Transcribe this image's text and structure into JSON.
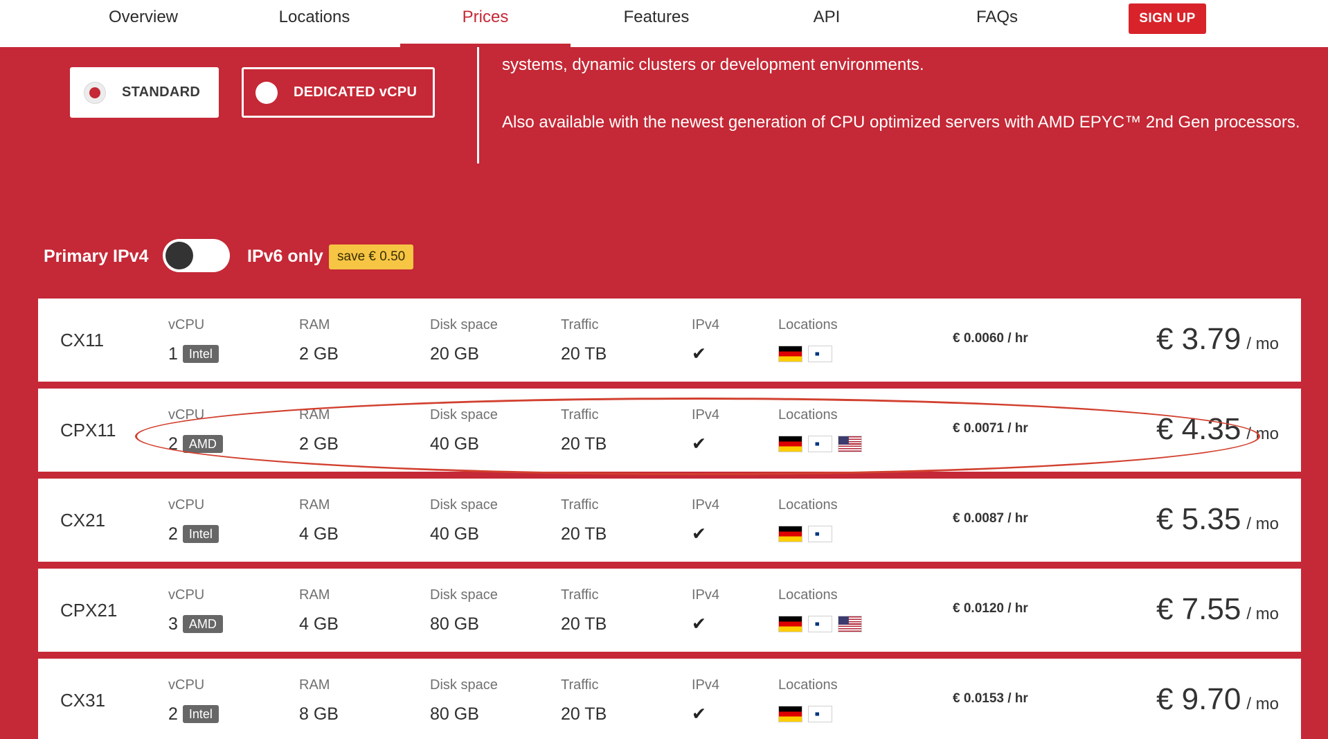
{
  "nav": {
    "items": [
      {
        "label": "Overview"
      },
      {
        "label": "Locations"
      },
      {
        "label": "Prices"
      },
      {
        "label": "Features"
      },
      {
        "label": "API"
      },
      {
        "label": "FAQs"
      }
    ],
    "active": "Prices",
    "signup_label": "SIGN UP"
  },
  "server_type": {
    "standard_label": "STANDARD",
    "dedicated_label": "DEDICATED vCPU",
    "selected": "STANDARD"
  },
  "description": {
    "line1": "systems, dynamic clusters or development environments.",
    "line2": "Also available with the newest generation of CPU optimized servers with AMD EPYC™ 2nd Gen processors."
  },
  "ip_toggle": {
    "primary_label": "Primary IPv4",
    "ipv6_label": "IPv6 only",
    "save_badge": "save € 0.50",
    "ipv6_only_enabled": false
  },
  "columns": {
    "vcpu": "vCPU",
    "ram": "RAM",
    "disk": "Disk space",
    "traffic": "Traffic",
    "ipv4": "IPv4",
    "locations": "Locations"
  },
  "plans": [
    {
      "name": "CX11",
      "vcpu": "1",
      "cpu_brand": "Intel",
      "ram": "2 GB",
      "disk": "20 GB",
      "traffic": "20 TB",
      "ipv4": "✔",
      "hourly": "€ 0.0060 / hr",
      "price": "€ 3.79",
      "unit": "/ mo"
    },
    {
      "name": "CPX11",
      "vcpu": "2",
      "cpu_brand": "AMD",
      "ram": "2 GB",
      "disk": "40 GB",
      "traffic": "20 TB",
      "ipv4": "✔",
      "hourly": "€ 0.0071 / hr",
      "price": "€ 4.35",
      "unit": "/ mo"
    },
    {
      "name": "CX21",
      "vcpu": "2",
      "cpu_brand": "Intel",
      "ram": "4 GB",
      "disk": "40 GB",
      "traffic": "20 TB",
      "ipv4": "✔",
      "hourly": "€ 0.0087 / hr",
      "price": "€ 5.35",
      "unit": "/ mo"
    },
    {
      "name": "CPX21",
      "vcpu": "3",
      "cpu_brand": "AMD",
      "ram": "4 GB",
      "disk": "80 GB",
      "traffic": "20 TB",
      "ipv4": "✔",
      "hourly": "€ 0.0120 / hr",
      "price": "€ 7.55",
      "unit": "/ mo"
    },
    {
      "name": "CX31",
      "vcpu": "2",
      "cpu_brand": "Intel",
      "ram": "8 GB",
      "disk": "80 GB",
      "traffic": "20 TB",
      "ipv4": "✔",
      "hourly": "€ 0.0153 / hr",
      "price": "€ 9.70",
      "unit": "/ mo"
    }
  ],
  "colors": {
    "brand_red": "#c52836",
    "signup_red": "#d8232a",
    "badge_yellow": "#f6c544",
    "chip_gray": "#676767",
    "highlight_outline": "#d2402f"
  },
  "icons": {
    "ipv4": "check-icon",
    "locations": [
      "flag-germany-icon",
      "flag-finland-icon",
      "flag-usa-icon"
    ]
  }
}
